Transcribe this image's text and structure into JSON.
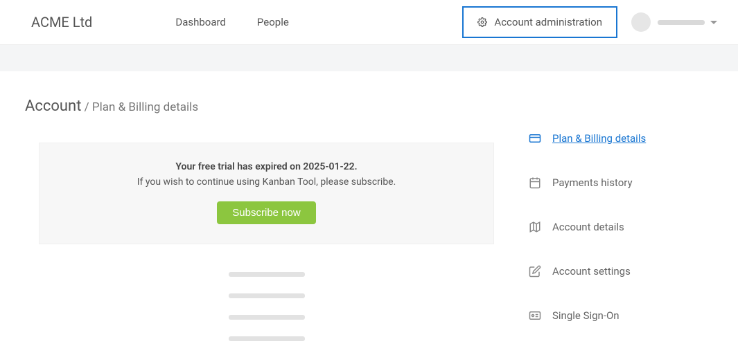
{
  "header": {
    "brand": "ACME Ltd",
    "nav": {
      "dashboard": "Dashboard",
      "people": "People"
    },
    "admin_label": "Account administration"
  },
  "breadcrumb": {
    "root": "Account",
    "separator": " / ",
    "sub": "Plan & Billing details"
  },
  "notice": {
    "title": "Your free trial has expired on 2025-01-22.",
    "subtitle": "If you wish to continue using Kanban Tool, please subscribe.",
    "button": "Subscribe now"
  },
  "sidebar": {
    "plan_billing": "Plan & Billing details",
    "payments_history": "Payments history",
    "account_details": "Account details",
    "account_settings": "Account settings",
    "sso": "Single Sign-On"
  }
}
